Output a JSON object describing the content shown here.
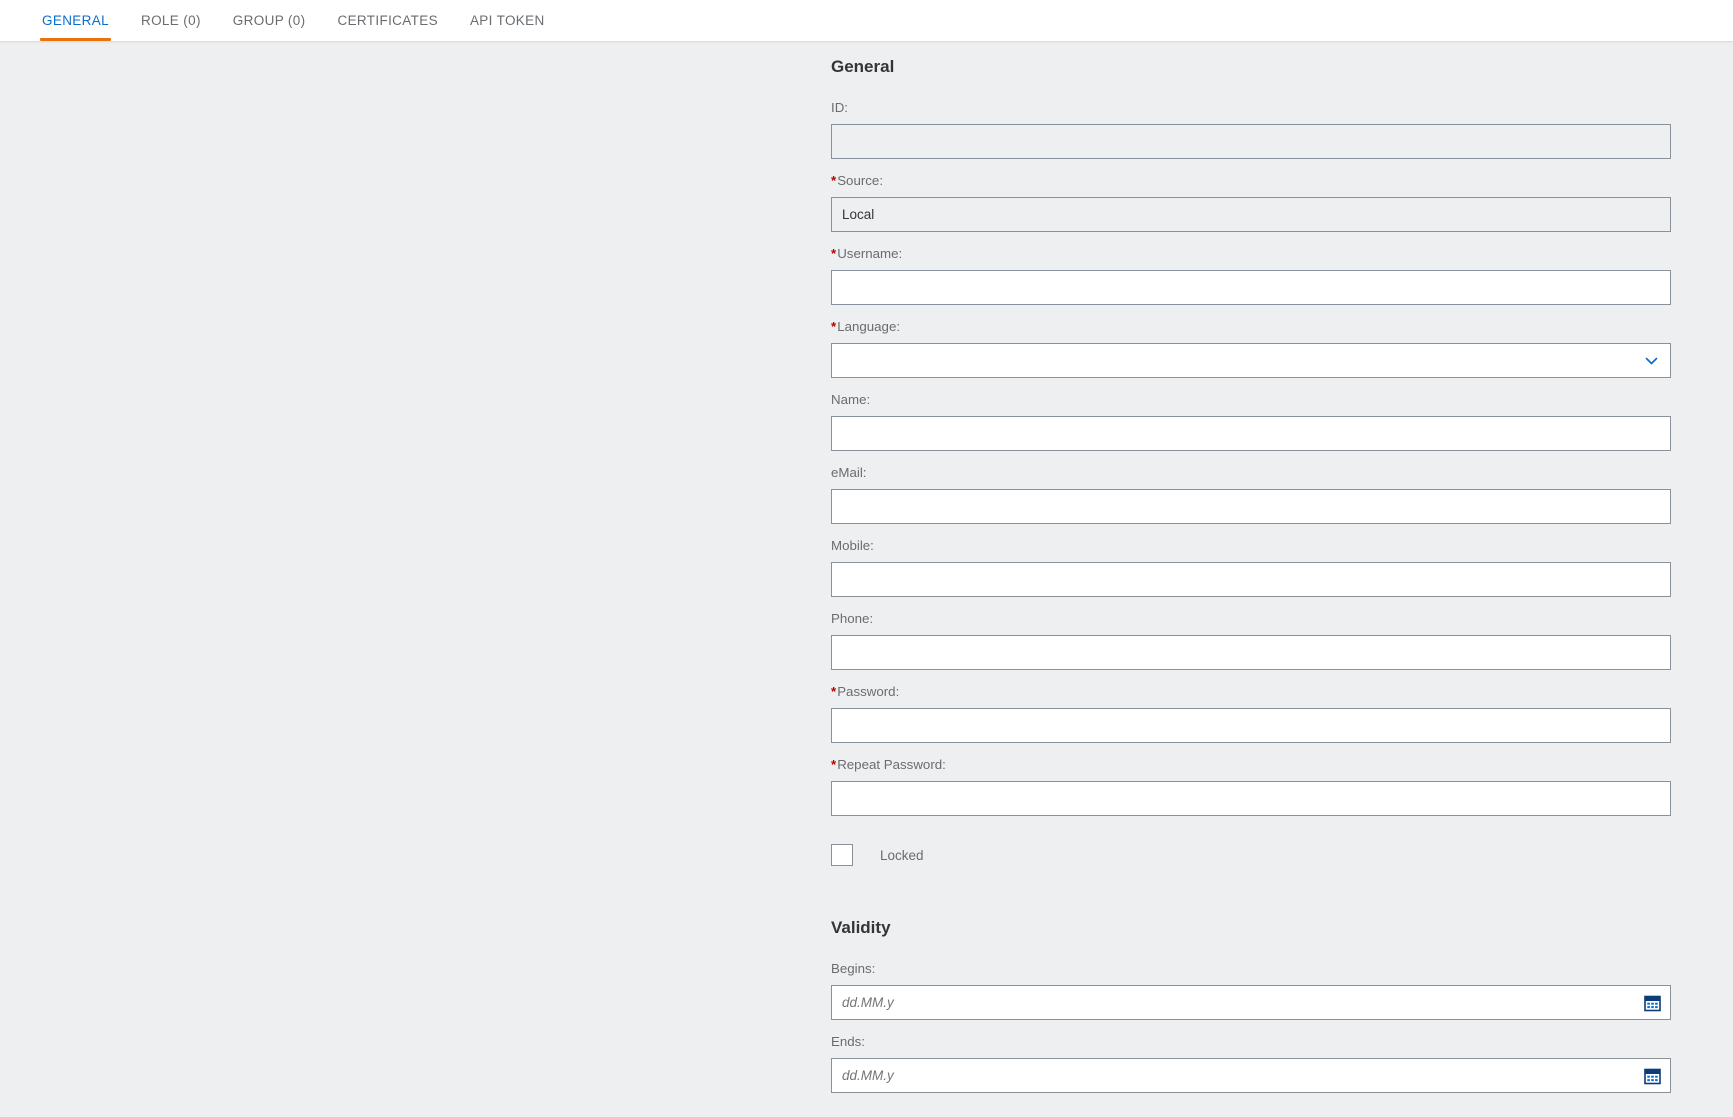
{
  "tabs": [
    {
      "label": "GENERAL",
      "active": true
    },
    {
      "label": "ROLE (0)",
      "active": false
    },
    {
      "label": "GROUP (0)",
      "active": false
    },
    {
      "label": "CERTIFICATES",
      "active": false
    },
    {
      "label": "API TOKEN",
      "active": false
    }
  ],
  "general": {
    "heading": "General",
    "fields": {
      "id": {
        "label": "ID:",
        "required": false,
        "value": "",
        "disabled": true
      },
      "source": {
        "label": "Source:",
        "required": true,
        "value": "Local",
        "disabled": true
      },
      "username": {
        "label": "Username:",
        "required": true,
        "value": ""
      },
      "language": {
        "label": "Language:",
        "required": true,
        "value": "",
        "icon": "chevron-down-icon"
      },
      "name": {
        "label": "Name:",
        "required": false,
        "value": ""
      },
      "email": {
        "label": "eMail:",
        "required": false,
        "value": ""
      },
      "mobile": {
        "label": "Mobile:",
        "required": false,
        "value": ""
      },
      "phone": {
        "label": "Phone:",
        "required": false,
        "value": ""
      },
      "password": {
        "label": "Password:",
        "required": true,
        "value": ""
      },
      "repeat_password": {
        "label": "Repeat Password:",
        "required": true,
        "value": ""
      }
    },
    "locked": {
      "label": "Locked",
      "checked": false
    }
  },
  "validity": {
    "heading": "Validity",
    "begins": {
      "label": "Begins:",
      "value": "",
      "placeholder": "dd.MM.y",
      "icon": "calendar-icon"
    },
    "ends": {
      "label": "Ends:",
      "value": "",
      "placeholder": "dd.MM.y",
      "icon": "calendar-icon"
    }
  },
  "required_marker": "*",
  "colors": {
    "accent_blue": "#0a6ed1",
    "active_underline": "#e9730c",
    "required_red": "#bb0000",
    "page_background": "#edeff0",
    "label_text": "#6a6d70",
    "heading_text": "#32363a",
    "input_border": "#89919a"
  }
}
